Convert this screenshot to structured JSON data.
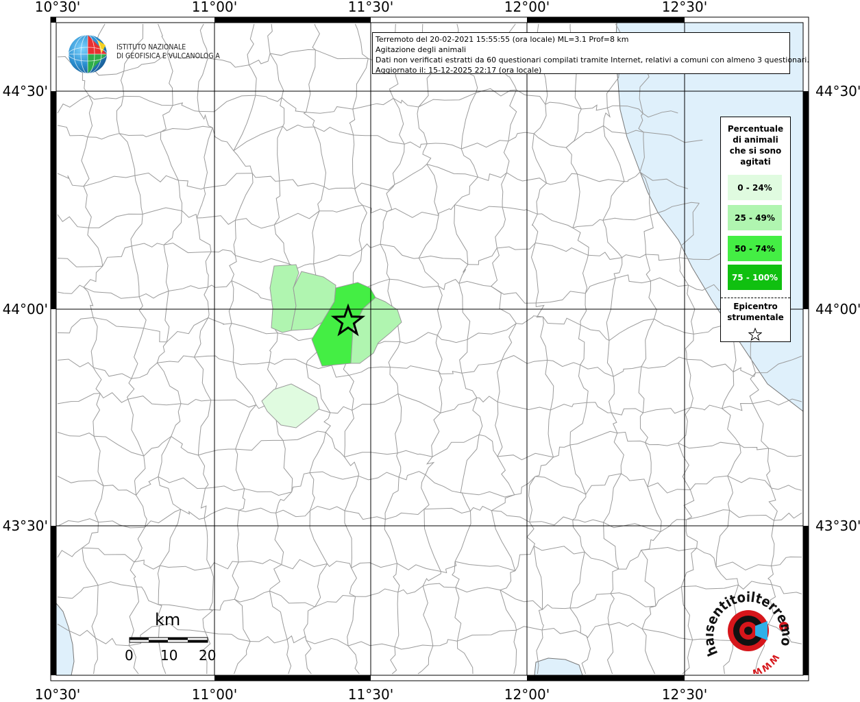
{
  "map": {
    "lon_ticks": [
      "10°30'",
      "11°00'",
      "11°30'",
      "12°00'",
      "12°30'"
    ],
    "lat_ticks": [
      "44°30'",
      "44°00'",
      "43°30'"
    ],
    "colors": {
      "sea": "#dff0fb",
      "class_0_24": "#e0fbe0",
      "class_25_49": "#b0f5b0",
      "class_50_74": "#44ee44",
      "class_75_100": "#10c010",
      "boundary": "#9a9a9a"
    }
  },
  "info": {
    "line1": "Terremoto del 20-02-2021 15:55:55 (ora locale) ML=3.1 Prof=8 km",
    "line2": "Agitazione degli animali",
    "line3": "Dati non verificati estratti da 60 questionari compilati tramite Internet, relativi a comuni con almeno 3 questionari.",
    "line4": "Aggiornato il: 15-12-2025 22:17 (ora locale)"
  },
  "logo": {
    "line1": "ISTITUTO NAZIONALE",
    "line2": "DI GEOFISICA E VULCANOLOGIA"
  },
  "legend": {
    "title_l1": "Percentuale",
    "title_l2": "di animali",
    "title_l3": "che si sono",
    "title_l4": "agitati",
    "items": [
      {
        "label": "0 - 24%",
        "color": "#e0fbe0"
      },
      {
        "label": "25 - 49%",
        "color": "#b0f5b0"
      },
      {
        "label": "50 - 74%",
        "color": "#44ee44"
      },
      {
        "label": "75 - 100%",
        "color": "#10c010"
      }
    ],
    "epicenter_l1": "Epicentro",
    "epicenter_l2": "strumentale"
  },
  "scale": {
    "unit": "km",
    "labels": [
      "0",
      "10",
      "20"
    ]
  },
  "watermark": {
    "text": "haisentitoilterremoto.it",
    "url_text": "WWW."
  }
}
